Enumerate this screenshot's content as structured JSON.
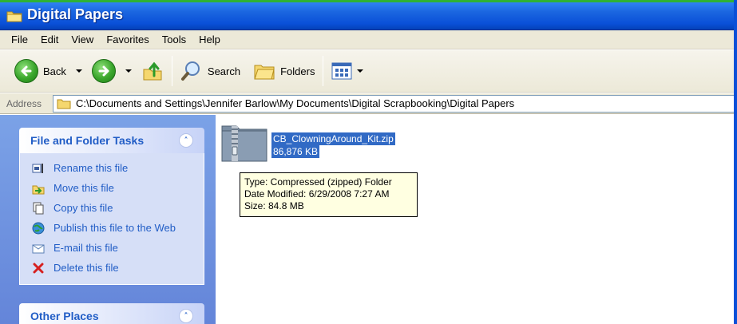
{
  "window": {
    "title": "Digital Papers",
    "accent_color": "#0a50d8"
  },
  "menu": {
    "items": [
      "File",
      "Edit",
      "View",
      "Favorites",
      "Tools",
      "Help"
    ]
  },
  "toolbar": {
    "back_label": "Back",
    "search_label": "Search",
    "folders_label": "Folders"
  },
  "address": {
    "label": "Address",
    "path": "C:\\Documents and Settings\\Jennifer Barlow\\My Documents\\Digital Scrapbooking\\Digital Papers"
  },
  "sidebar": {
    "file_tasks": {
      "title": "File and Folder Tasks",
      "items": [
        {
          "label": "Rename this file",
          "icon": "rename-icon"
        },
        {
          "label": "Move this file",
          "icon": "move-icon"
        },
        {
          "label": "Copy this file",
          "icon": "copy-icon"
        },
        {
          "label": "Publish this file to the Web",
          "icon": "publish-web-icon"
        },
        {
          "label": "E-mail this file",
          "icon": "email-icon"
        },
        {
          "label": "Delete this file",
          "icon": "delete-icon"
        }
      ]
    },
    "other_places": {
      "title": "Other Places"
    }
  },
  "file": {
    "name": "CB_ClowningAround_Kit.zip",
    "size": "86,876 KB",
    "selected_color": "#316ac5"
  },
  "tooltip": {
    "type": "Type: Compressed (zipped) Folder",
    "modified": "Date Modified: 6/29/2008 7:27 AM",
    "size": "Size: 84.8 MB"
  }
}
